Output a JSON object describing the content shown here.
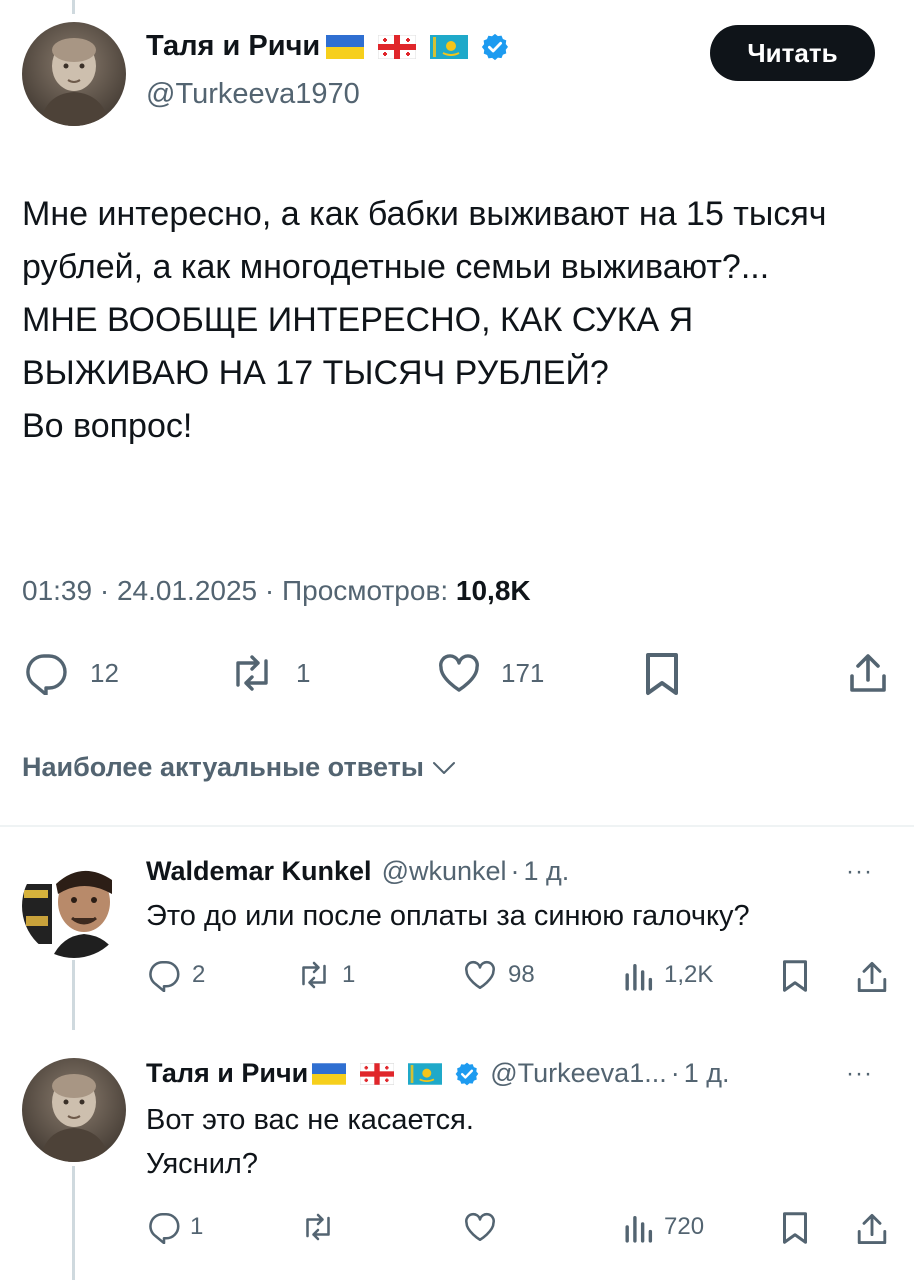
{
  "main_tweet": {
    "author": {
      "display_name": "Таля и Ричи",
      "handle": "@Turkeeva1970",
      "flags": [
        "flag-ukraine",
        "flag-georgia",
        "flag-kazakhstan"
      ],
      "verified": true
    },
    "follow_label": "Читать",
    "text": "Мне интересно, а как бабки выживают на 15 тысяч рублей, а как многодетные семьи выживают?...\nМНЕ ВООБЩЕ ИНТЕРЕСНО, КАК СУКА Я ВЫЖИВАЮ НА 17 ТЫСЯЧ РУБЛЕЙ?\nВо вопрос!",
    "meta": {
      "time": "01:39",
      "date": "24.01.2025",
      "views_label": "Просмотров:",
      "views_value": "10,8K",
      "separator": "·"
    },
    "actions": {
      "replies": "12",
      "retweets": "1",
      "likes": "171"
    }
  },
  "replies_sort": {
    "label": "Наиболее актуальные ответы"
  },
  "replies": [
    {
      "display_name": "Waldemar Kunkel",
      "handle": "@wkunkel",
      "age": "1 д.",
      "separator": "·",
      "more": "···",
      "text": "Это до или после оплаты за синюю галочку?",
      "actions": {
        "replies": "2",
        "retweets": "1",
        "likes": "98",
        "views": "1,2K"
      }
    },
    {
      "display_name": "Таля и Ричи",
      "handle": "@Turkeeva1...",
      "age": "1 д.",
      "separator": "·",
      "more": "···",
      "flags": [
        "flag-ukraine",
        "flag-georgia",
        "flag-kazakhstan"
      ],
      "verified": true,
      "text": "Вот это вас не касается.\nУяснил?",
      "actions": {
        "replies": "1",
        "retweets": "",
        "likes": "",
        "views": "720"
      }
    }
  ],
  "colors": {
    "text": "#0f1419",
    "muted": "#536471",
    "verified": "#1d9bf0",
    "divider": "#eff3f4",
    "thread_line": "#cfd9de",
    "follow_bg": "#0f1419"
  }
}
